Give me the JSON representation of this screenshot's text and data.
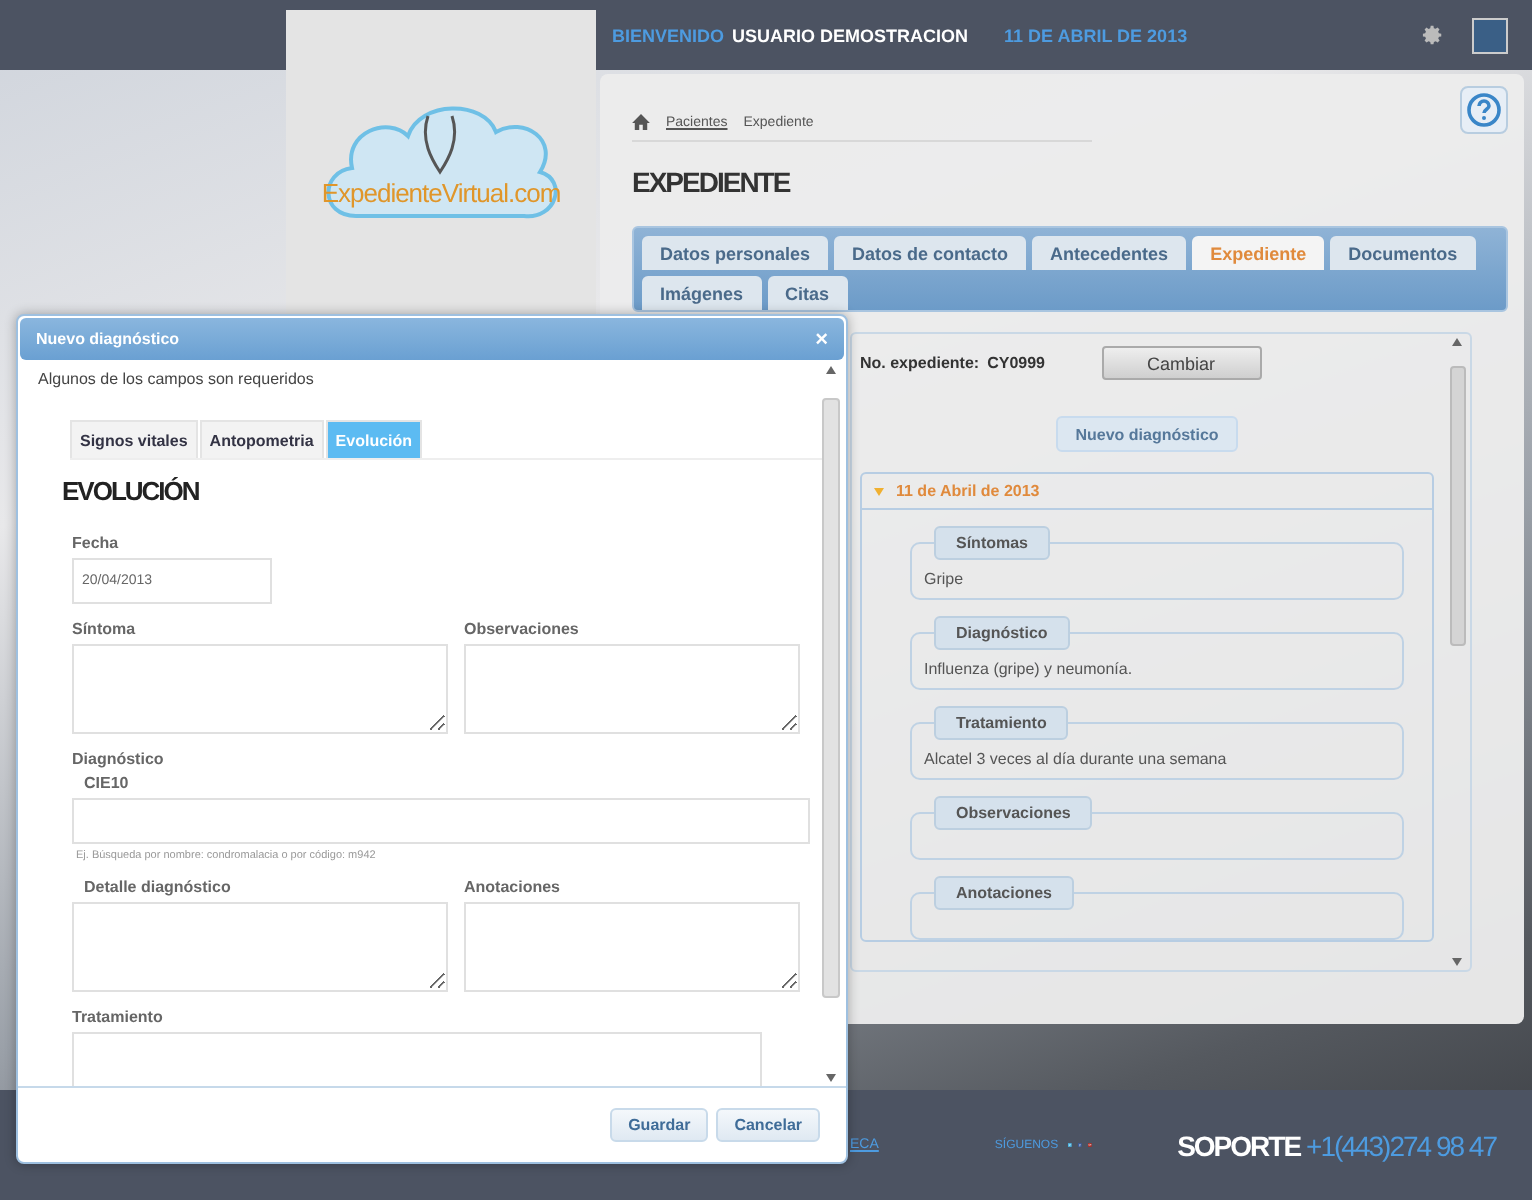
{
  "top_bar": {
    "welcome": "BIENVENIDO",
    "user": "USUARIO DEMOSTRACION",
    "date": "11 DE ABRIL DE 2013"
  },
  "logo": {
    "text": "ExpedienteVirtual.com"
  },
  "breadcrumb": [
    {
      "label": "Pacientes",
      "kind": "link"
    },
    {
      "label": "Expediente",
      "kind": "current"
    }
  ],
  "page_title": "EXPEDIENTE",
  "tabs": [
    {
      "label": "Datos personales",
      "selected": false
    },
    {
      "label": "Datos de contacto",
      "selected": false
    },
    {
      "label": "Antecedentes",
      "selected": false
    },
    {
      "label": "Expediente",
      "selected": true
    },
    {
      "label": "Documentos",
      "selected": false
    },
    {
      "label": "Imágenes",
      "selected": false
    },
    {
      "label": "Citas",
      "selected": false
    }
  ],
  "record": {
    "label": "No. expediente:",
    "number": "CY0999",
    "change_button": "Cambiar"
  },
  "new_diagnosis_button": "Nuevo diagnóstico",
  "entry": {
    "date": "11 de Abril de 2013",
    "expanded": true,
    "sections": [
      {
        "title": "Síntomas",
        "text": "Gripe"
      },
      {
        "title": "Diagnóstico",
        "text": "Influenza (gripe) y neumonía."
      },
      {
        "title": "Tratamiento",
        "text": "Alcatel 3 veces al día durante una semana"
      },
      {
        "title": "Observaciones"
      },
      {
        "title": "Anotaciones"
      }
    ]
  },
  "footer": {
    "link": "ECA",
    "follow": "SÍGUENOS",
    "support_label": "SOPORTE",
    "phone": "+1(443)274 98 47"
  },
  "dialog": {
    "title": "Nuevo diagnóstico",
    "close": "×",
    "note": "Algunos de los campos son requeridos",
    "tabs": [
      {
        "label": "Signos vitales",
        "selected": false
      },
      {
        "label": "Antopometria",
        "selected": false
      },
      {
        "label": "Evolución",
        "selected": true
      }
    ],
    "heading": "EVOLUCIÓN",
    "date_field": {
      "label": "Fecha",
      "value": "20/04/2013"
    },
    "row_1": [
      {
        "label": "Síntoma"
      },
      {
        "label": "Observaciones"
      }
    ],
    "diagnosis": {
      "label": "Diagnóstico",
      "sublabel": "CIE10",
      "hint": "Ej. Búsqueda por nombre: condromalacia o por código: m942"
    },
    "row_2": [
      {
        "label": "Detalle diagnóstico"
      },
      {
        "label": "Anotaciones"
      }
    ],
    "treatment": {
      "label": "Tratamiento"
    },
    "buttons": [
      "Guardar",
      "Cancelar"
    ]
  }
}
